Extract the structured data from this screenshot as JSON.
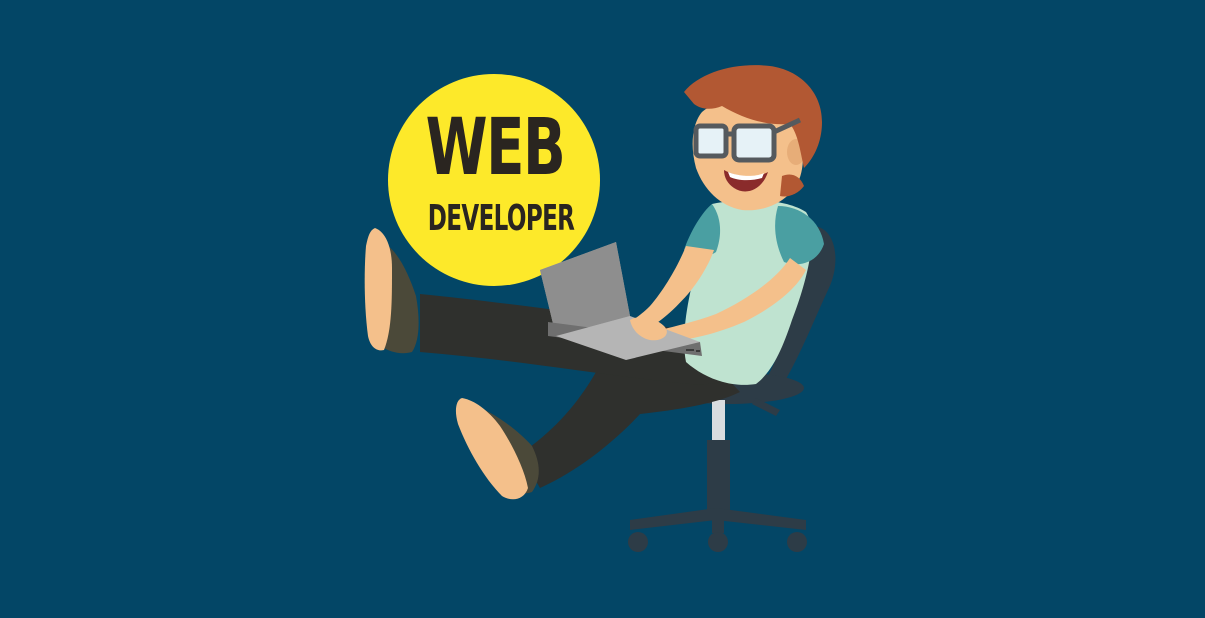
{
  "colors": {
    "background": "#034666",
    "badge": "#fde92a",
    "badge_text": "#2a2520",
    "hair": "#b25833",
    "skin": "#f4c08b",
    "shirt": "#bfe3d0",
    "sleeve": "#4a9fa2",
    "pants": "#2f302d",
    "shoe": "#4b4939",
    "chair": "#2d3c47",
    "laptop": "#9a9a9a"
  },
  "badge": {
    "line1": "WEB",
    "line2": "DEVELOPER"
  },
  "icons": {
    "badge": "circle-badge",
    "character": "developer-illustration",
    "laptop": "laptop-icon",
    "chair": "office-chair-icon"
  }
}
